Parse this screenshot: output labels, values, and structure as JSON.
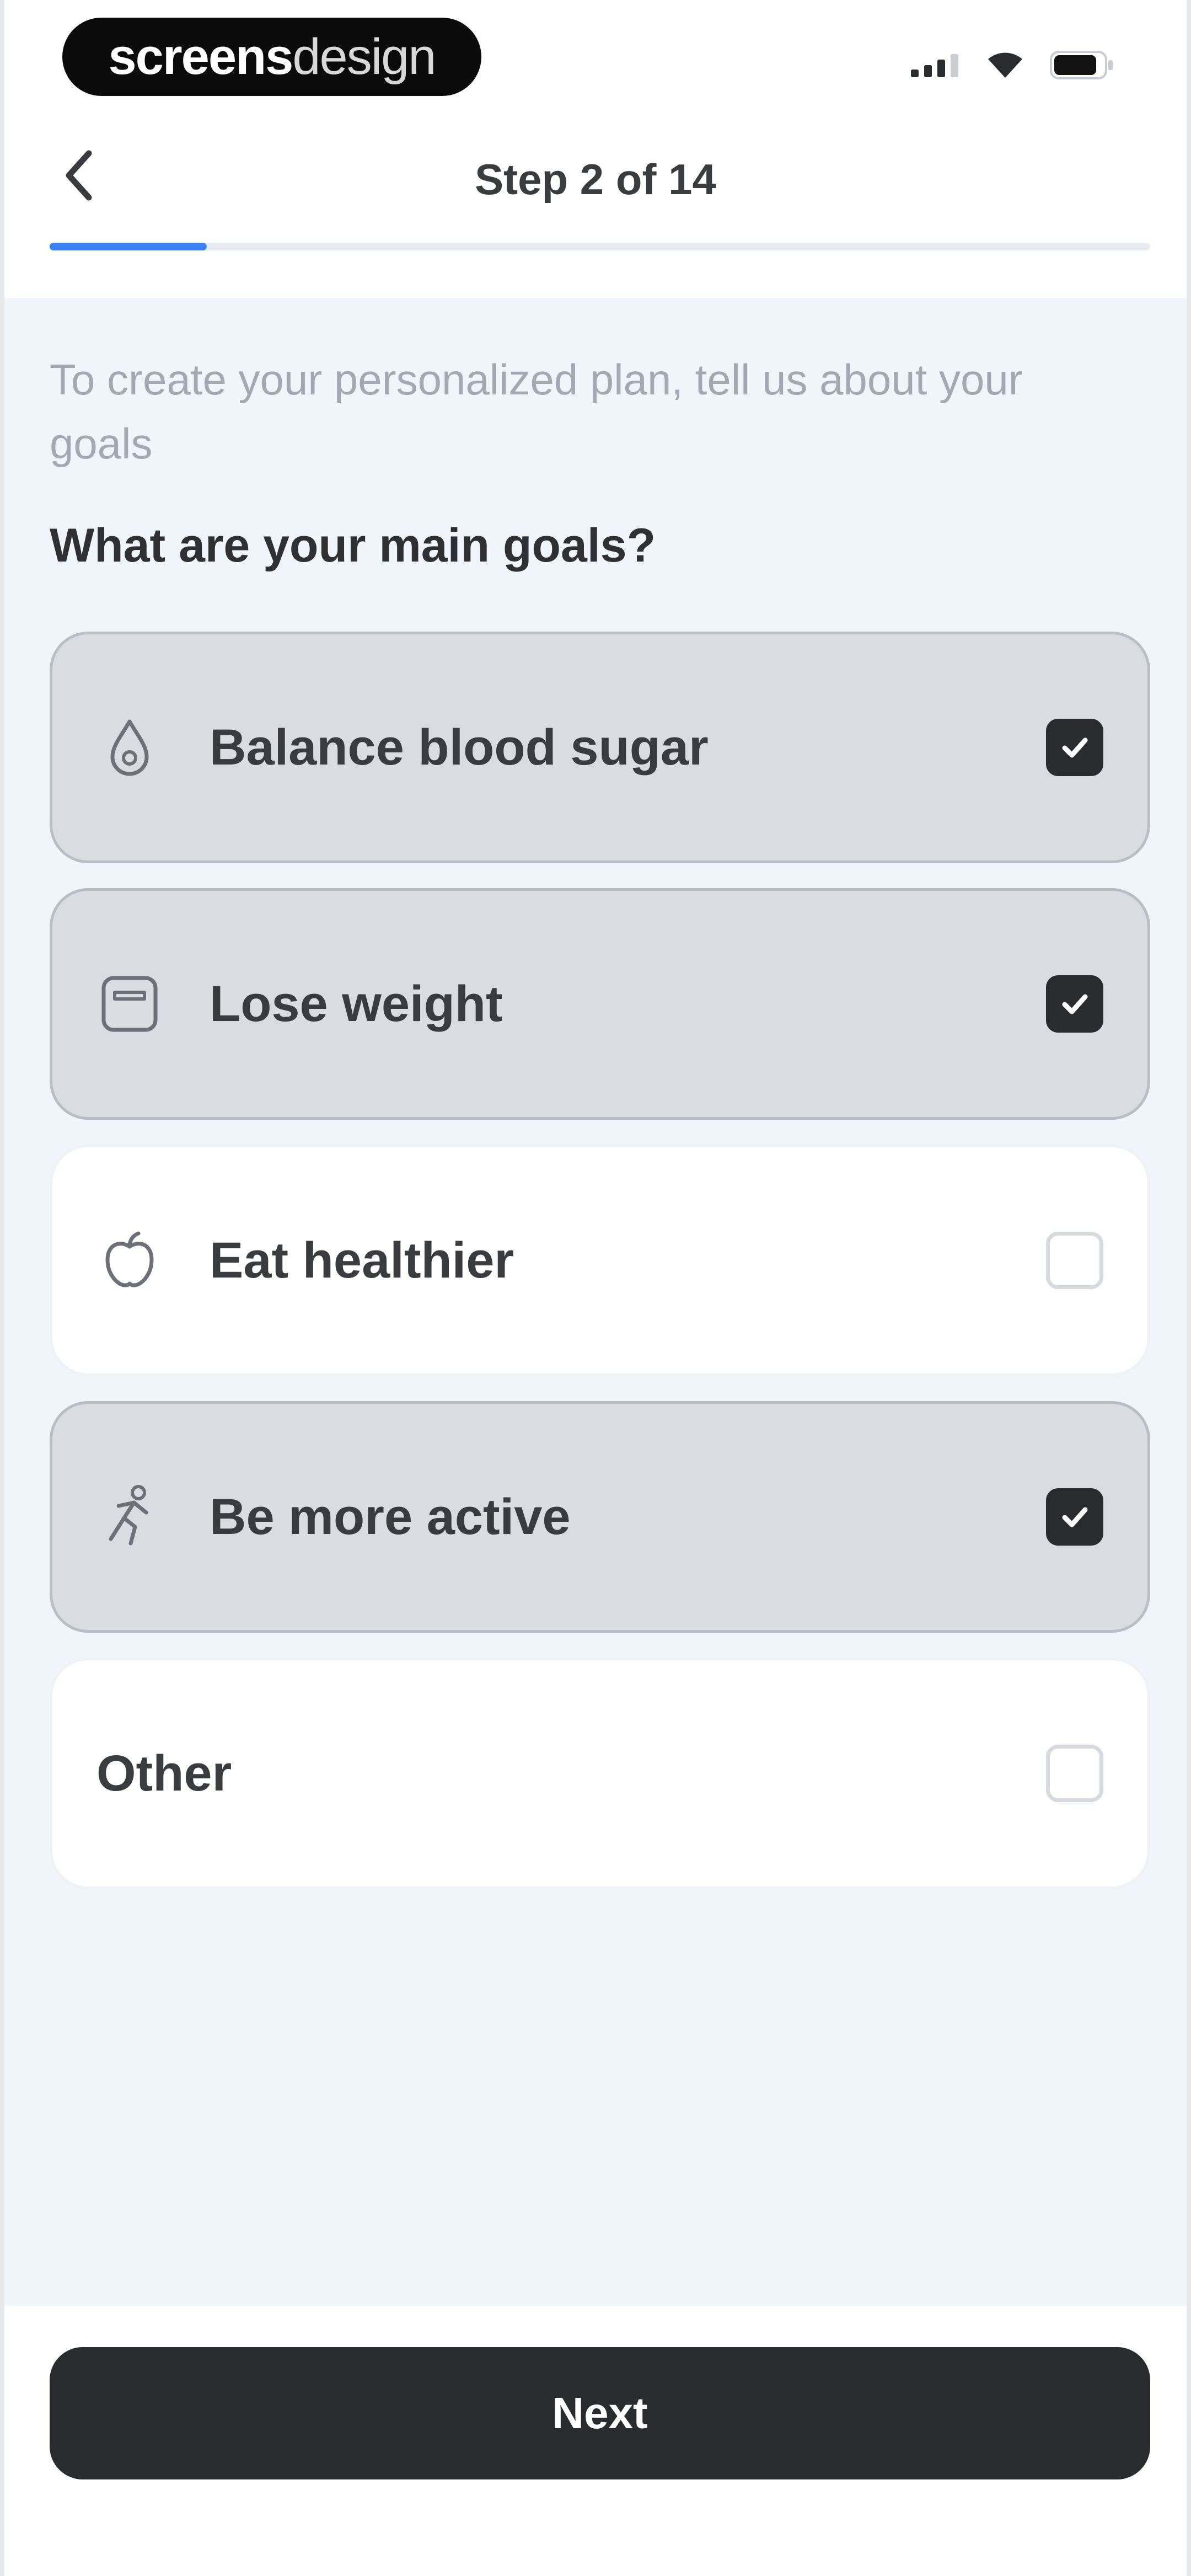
{
  "status_bar": {
    "brand_bold": "screens",
    "brand_light": "design",
    "icons": [
      "signal-icon",
      "wifi-icon",
      "battery-icon"
    ]
  },
  "header": {
    "title": "Step 2 of 14",
    "progress_fraction": 0.143
  },
  "intro_text": "To create your personalized plan, tell us about your goals",
  "question": "What are your main goals?",
  "options": [
    {
      "label": "Balance blood sugar",
      "icon": "blood-drop-icon",
      "selected": true
    },
    {
      "label": "Lose weight",
      "icon": "scale-icon",
      "selected": true
    },
    {
      "label": "Eat healthier",
      "icon": "apple-icon",
      "selected": false
    },
    {
      "label": "Be more active",
      "icon": "running-person-icon",
      "selected": true
    },
    {
      "label": "Other",
      "icon": null,
      "selected": false
    }
  ],
  "footer": {
    "next_label": "Next"
  },
  "colors": {
    "accent": "#3b82f6",
    "selected_bg": "#d9dde2",
    "button_bg": "#2a2b2f",
    "content_bg": "#f0f4fb"
  }
}
